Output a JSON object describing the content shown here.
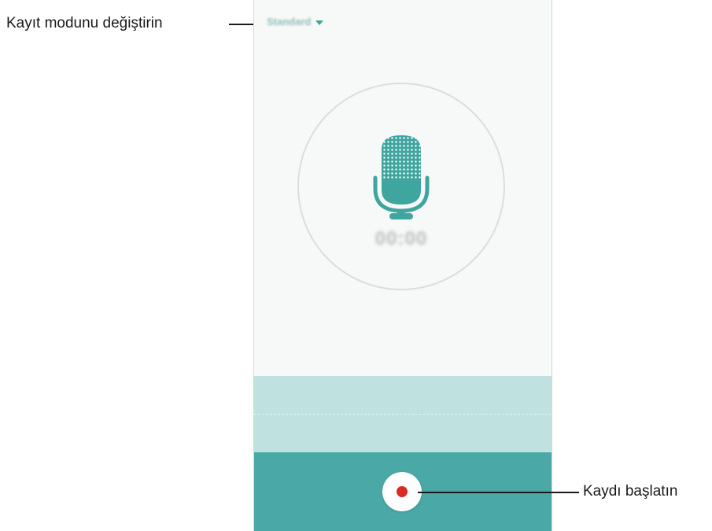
{
  "callouts": {
    "change_mode": "Kayıt modunu değiştirin",
    "start_recording": "Kaydı başlatın"
  },
  "recorder": {
    "mode": "Standard",
    "timer": "00:00"
  },
  "icons": {
    "mode_dropdown": "chevron-down-icon",
    "microphone": "microphone-icon",
    "record": "record-icon"
  },
  "colors": {
    "accent": "#4aa9a6",
    "waveform_bg": "#bfe1e0",
    "record_dot": "#d62c24",
    "screen_bg": "#f7f8f8"
  }
}
